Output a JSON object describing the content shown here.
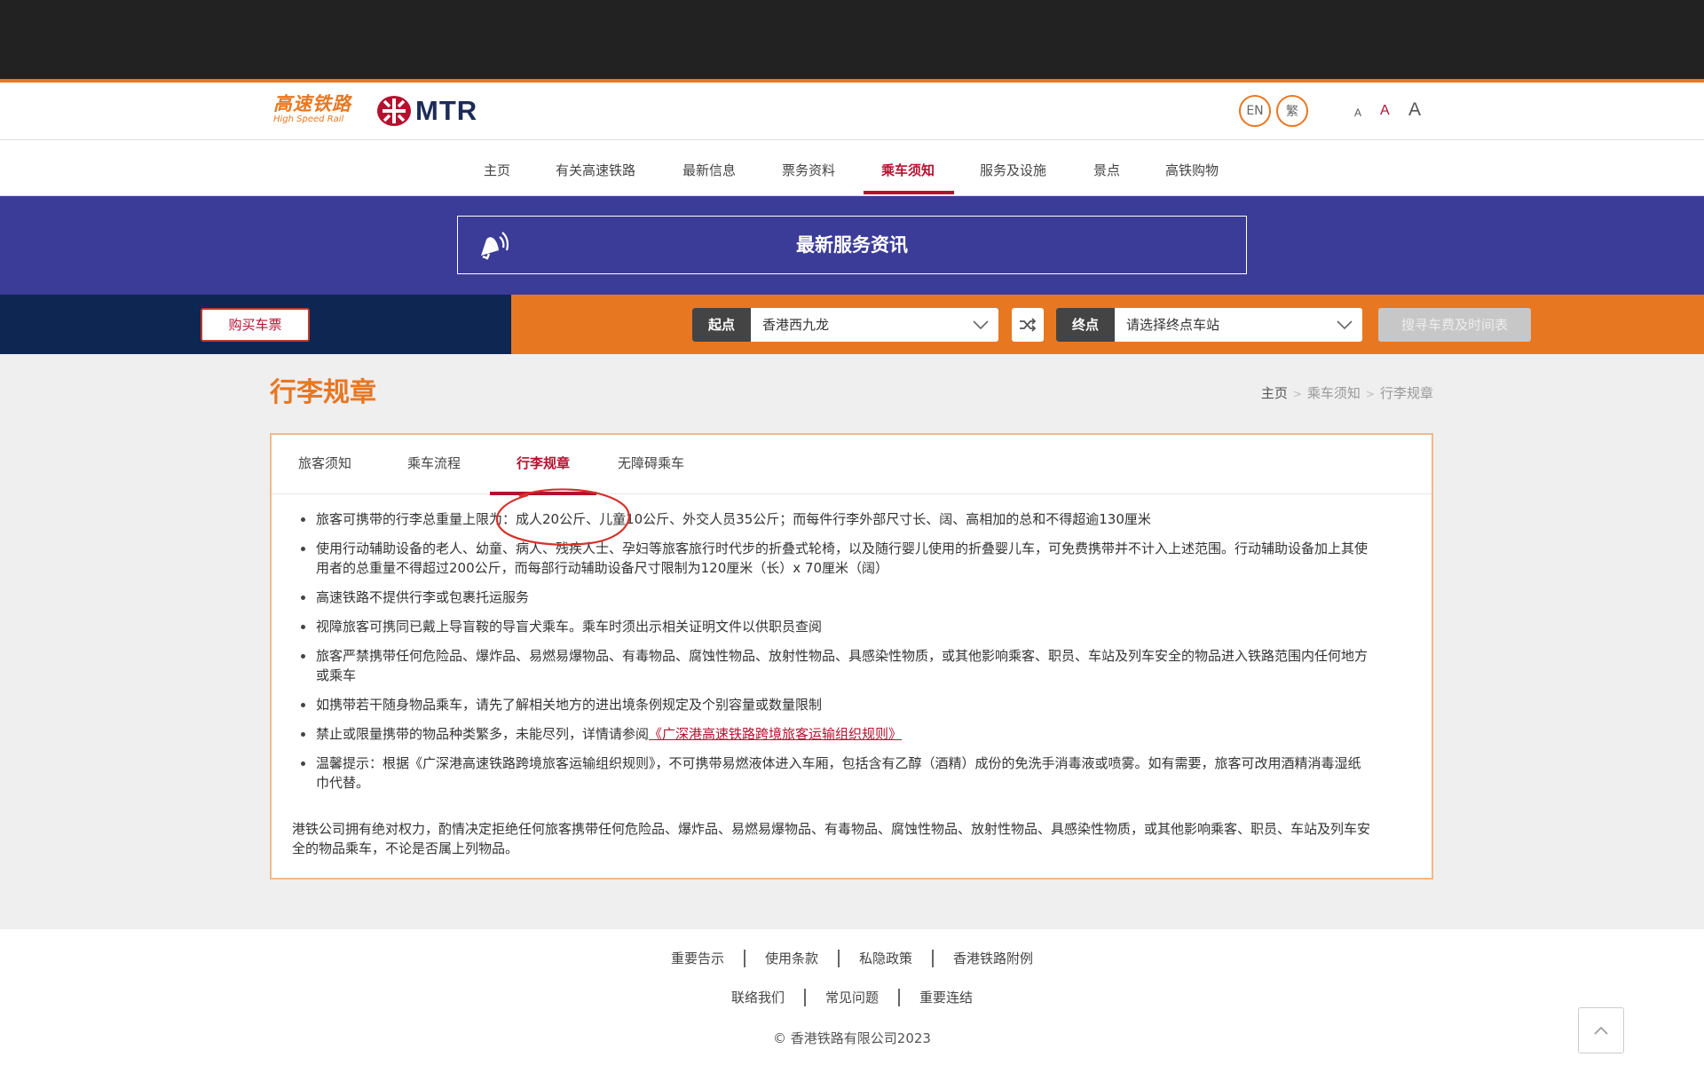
{
  "header": {
    "logo_hsr_cn": "高速铁路",
    "logo_hsr_en": "High Speed Rail",
    "logo_mtr": "MTR",
    "lang_en": "EN",
    "lang_tc": "繁",
    "font_small": "A",
    "font_medium": "A",
    "font_large": "A"
  },
  "nav": {
    "items": [
      {
        "label": "主页"
      },
      {
        "label": "有关高速铁路"
      },
      {
        "label": "最新信息"
      },
      {
        "label": "票务资料"
      },
      {
        "label": "乘车须知",
        "active": true
      },
      {
        "label": "服务及设施"
      },
      {
        "label": "景点"
      },
      {
        "label": "高铁购物"
      }
    ]
  },
  "banner": {
    "title": "最新服务资讯",
    "icon": "megaphone-icon"
  },
  "ticket_bar": {
    "buy_label": "购买车票",
    "origin_label": "起点",
    "origin_value": "香港西九龙",
    "dest_label": "终点",
    "dest_value": "请选择终点车站",
    "search_label": "搜寻车费及时间表"
  },
  "page": {
    "title": "行李规章",
    "breadcrumb": {
      "home": "主页",
      "level1": "乘车须知",
      "current": "行李规章"
    }
  },
  "tabs": [
    {
      "label": "旅客须知"
    },
    {
      "label": "乘车流程"
    },
    {
      "label": "行李规章",
      "active": true
    },
    {
      "label": "无障碍乘车"
    }
  ],
  "rules": {
    "r1": "旅客可携带的行李总重量上限为：成人20公斤、儿童10公斤、外交人员35公斤；而每件行李外部尺寸长、阔、高相加的总和不得超逾130厘米",
    "r2a": "使用行动辅助设备的老人、幼童、病人、残疾人士、孕妇等旅客旅行时代步的折叠式轮椅，以及随行婴儿使用的折叠婴儿车，可免费携带并不计入上述范围。行动辅助设备加上其使",
    "r2b": "用者的总重量不得超过200公斤，而每部行动辅助设备尺寸限制为120厘米（长）x 70厘米（阔）",
    "r3": "高速铁路不提供行李或包裹托运服务",
    "r4": "视障旅客可携同已戴上导盲鞍的导盲犬乘车。乘车时须出示相关证明文件以供职员查阅",
    "r5a": "旅客严禁携带任何危险品、爆炸品、易燃易爆物品、有毒物品、腐蚀性物品、放射性物品、具感染性物质，或其他影响乘客、职员、车站及列车安全的物品进入铁路范围内任何地方",
    "r5b": "或乘车",
    "r6": "如携带若干随身物品乘车，请先了解相关地方的进出境条例规定及个别容量或数量限制",
    "r7_text": "禁止或限量携带的物品种类繁多，未能尽列，详情请参阅",
    "r7_link": "《广深港高速铁路跨境旅客运输组织规则》",
    "r8a": "温馨提示：根据《广深港高速铁路跨境旅客运输组织规则》，不可携带易燃液体进入车厢，包括含有乙醇（酒精）成份的免洗手消毒液或喷雾。如有需要，旅客可改用酒精消毒湿纸",
    "r8b": "巾代替。"
  },
  "note": {
    "line1": "港铁公司拥有绝对权力，酌情决定拒绝任何旅客携带任何危险品、爆炸品、易燃易爆物品、有毒物品、腐蚀性物品、放射性物品、具感染性物质，或其他影响乘客、职员、车站及列车安",
    "line2": "全的物品乘车，不论是否属上列物品。"
  },
  "footer": {
    "row1": [
      {
        "label": "重要告示"
      },
      {
        "label": "使用条款"
      },
      {
        "label": "私隐政策"
      },
      {
        "label": "香港铁路附例"
      }
    ],
    "row2": [
      {
        "label": "联络我们"
      },
      {
        "label": "常见问题"
      },
      {
        "label": "重要连结"
      }
    ],
    "copyright": "© 香港铁路有限公司2023"
  },
  "colors": {
    "accent": "#e87722",
    "brand_red": "#b5112f",
    "banner_blue": "#3b3b98",
    "navy": "#0d2652"
  }
}
